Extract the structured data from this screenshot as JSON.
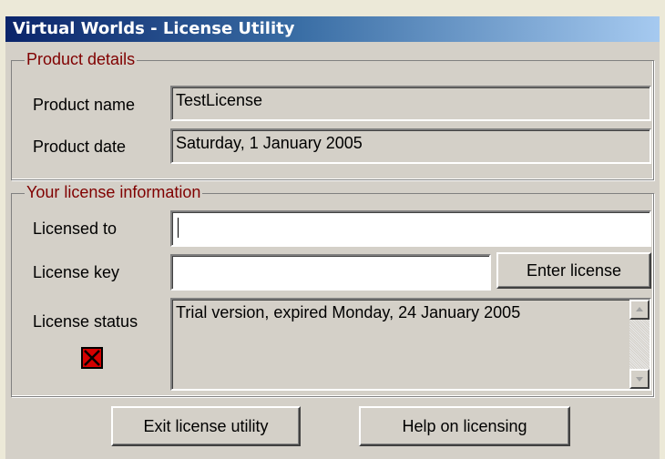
{
  "window": {
    "title": "Virtual Worlds - License Utility"
  },
  "product_details": {
    "legend": "Product details",
    "product_name_label": "Product name",
    "product_name_value": "TestLicense",
    "product_date_label": "Product date",
    "product_date_value": "Saturday, 1 January 2005"
  },
  "license_info": {
    "legend": "Your license information",
    "licensed_to_label": "Licensed to",
    "licensed_to_value": "",
    "license_key_label": "License key",
    "license_key_value": "",
    "enter_license_button": "Enter license",
    "license_status_label": "License status",
    "license_status_value": "Trial version, expired Monday, 24 January 2005",
    "status_icon": "red-x-icon"
  },
  "footer": {
    "exit_button": "Exit license utility",
    "help_button": "Help on licensing"
  },
  "colors": {
    "title_gradient_start": "#0a246a",
    "title_gradient_end": "#a6caf0",
    "legend_text": "#800000",
    "face": "#d4d0c8",
    "error_red": "#d40000"
  }
}
